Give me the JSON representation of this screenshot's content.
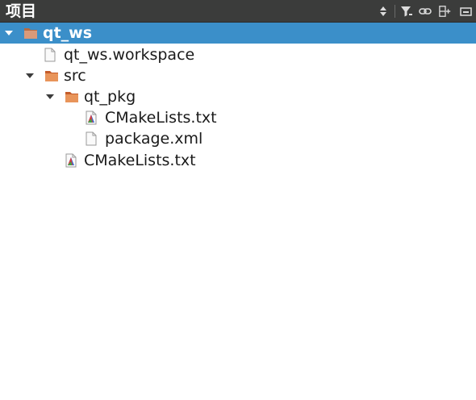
{
  "panel": {
    "title": "项目",
    "toolbar": [
      {
        "name": "sort-icon"
      },
      {
        "name": "filter-icon"
      },
      {
        "name": "link-icon"
      },
      {
        "name": "new-item-icon"
      },
      {
        "name": "minimize-icon"
      }
    ]
  },
  "tree": {
    "root": {
      "label": "qt_ws",
      "expanded": true,
      "selected": true
    },
    "workspace_file": {
      "label": "qt_ws.workspace"
    },
    "src": {
      "label": "src",
      "expanded": true
    },
    "qt_pkg": {
      "label": "qt_pkg",
      "expanded": true
    },
    "pkg_cmake": {
      "label": "CMakeLists.txt"
    },
    "pkg_xml": {
      "label": "package.xml"
    },
    "src_cmake": {
      "label": "CMakeLists.txt"
    }
  },
  "colors": {
    "header_bg": "#3b3c3b",
    "selection": "#3b8fc9",
    "folder_orange": "#e08a4a"
  }
}
